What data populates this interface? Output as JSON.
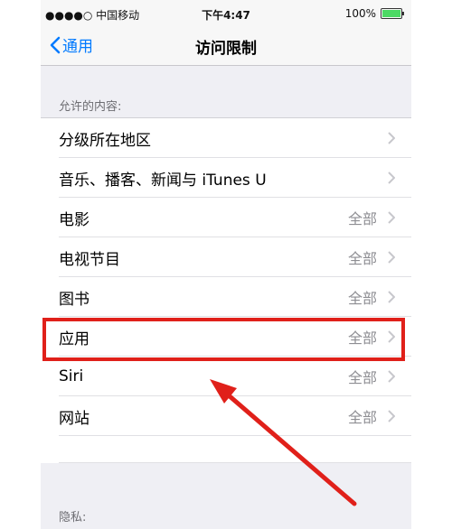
{
  "status_bar": {
    "carrier": "●●●●○ 中国移动",
    "time": "下午4:47",
    "battery": "100%"
  },
  "nav": {
    "back_label": "通用",
    "title": "访问限制"
  },
  "allowed_section": {
    "header": "允许的内容:",
    "rows": [
      {
        "label": "分级所在地区",
        "value": ""
      },
      {
        "label": "音乐、播客、新闻与 iTunes U",
        "value": ""
      },
      {
        "label": "电影",
        "value": "全部"
      },
      {
        "label": "电视节目",
        "value": "全部"
      },
      {
        "label": "图书",
        "value": "全部"
      },
      {
        "label": "应用",
        "value": "全部"
      },
      {
        "label": "Siri",
        "value": "全部"
      },
      {
        "label": "网站",
        "value": "全部"
      }
    ]
  },
  "privacy_section": {
    "header": "隐私:"
  },
  "colors": {
    "accent": "#007aff",
    "annotation": "#e0201a",
    "battery": "#4cd964"
  }
}
